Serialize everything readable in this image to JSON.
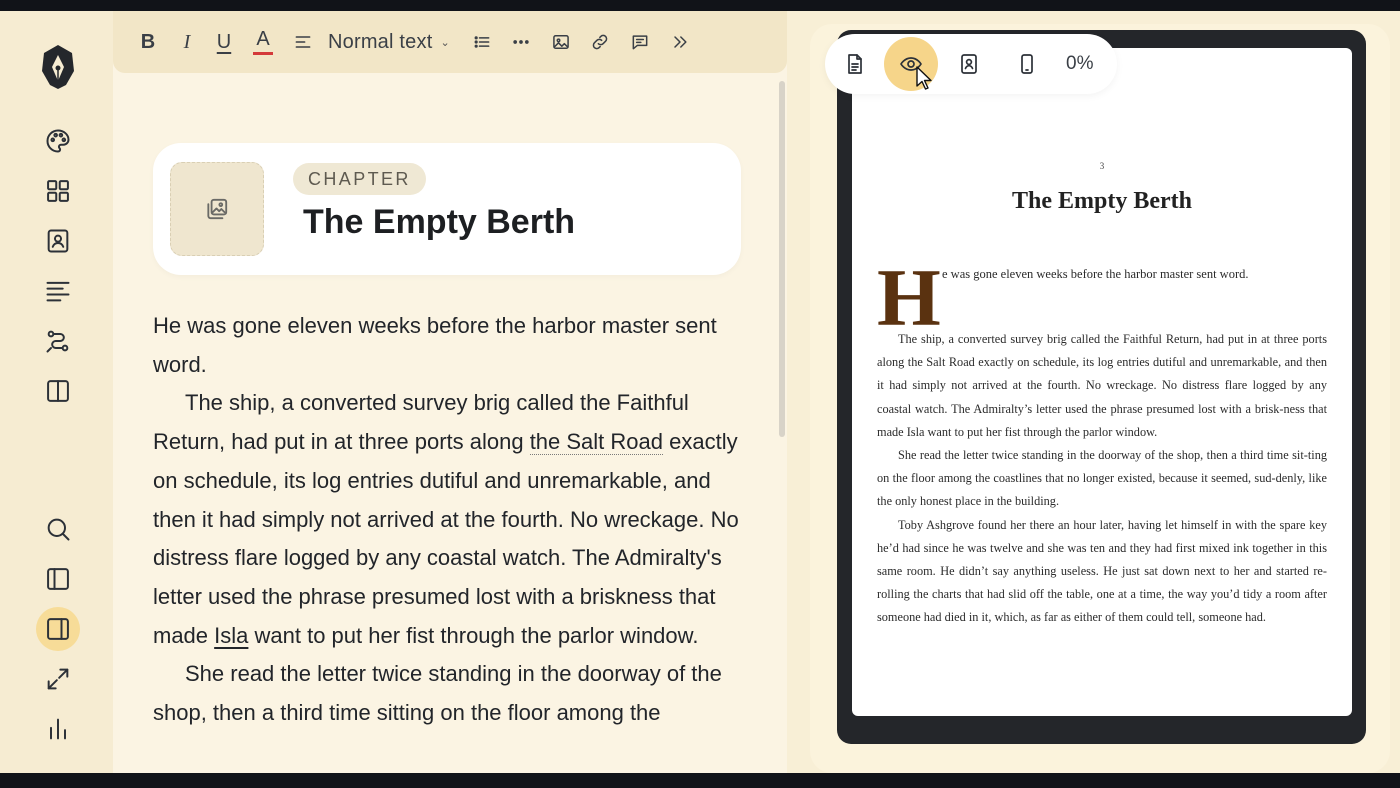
{
  "toolbar": {
    "bold": "B",
    "italic": "I",
    "underline": "U",
    "text_color": "A",
    "text_color_underline": "#d43a3a",
    "style_select": "Normal text",
    "caret": "⌄"
  },
  "chapter": {
    "label": "CHAPTER",
    "title": "The Empty Berth"
  },
  "editor_body": {
    "p1": "He was gone eleven weeks before the harbor master sent word.",
    "p2_a": "The ship, a converted survey brig called the Faithful Return, had put in at three ports along ",
    "p2_link": "the Salt Road",
    "p2_b": " exactly on schedule, its log entries dutiful and unremarkable, and then it had simply not arrived at the fourth. No wreckage. No distress flare logged by any coastal watch. The Admiralty's letter used the phrase presumed lost with a briskness that made ",
    "p2_name": "Isla",
    "p2_c": " want to put her fist through the parlor window.",
    "p3": "She read the letter twice standing in the doorway of the shop, then a third time sitting on the floor among the"
  },
  "preview": {
    "toolbar": {
      "percent": "0%"
    },
    "page_number": "3",
    "title": "The Empty Berth",
    "dropcap": "H",
    "first_line": "e was gone eleven weeks before the harbor master sent word.",
    "paragraphs": [
      "The ship, a converted survey brig called the Faithful Return, had put in at three ports along the Salt Road exactly on schedule, its log entries dutiful and unremarkable, and then it had simply not arrived at the fourth. No wreckage. No distress flare logged by any coastal watch. The Admiralty’s letter used the phrase presumed lost with a brisk-ness that made Isla want to put her fist through the parlor window.",
      "She read the letter twice standing in the doorway of the shop, then a third time sit-ting on the floor among the coastlines that no longer existed, because it seemed, sud-denly, like the only honest place in the building.",
      "Toby Ashgrove found her there an hour later, having let himself in with the spare key he’d had since he was twelve and she was ten and they had first mixed ink together in this same room. He didn’t say anything useless. He just sat down next to her and started re-rolling the charts that had slid off the table, one at a time, the way you’d tidy a room after someone had died in it, which, as far as either of them could tell, someone had."
    ]
  },
  "colors": {
    "accent": "#f6d58a",
    "dropcap": "#5a3210",
    "background": "#f8efd6"
  }
}
